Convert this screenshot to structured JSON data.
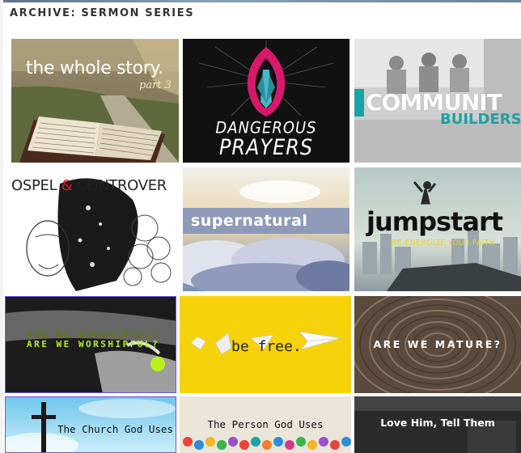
{
  "page": {
    "title": "ARCHIVE: SERMON SERIES"
  },
  "series": [
    {
      "title": "the whole story.",
      "subtitle": "part 3"
    },
    {
      "title": "DANGEROUS",
      "title2": "PRAYERS"
    },
    {
      "title": "COMMUNIT",
      "subtitle": "BUILDERS"
    },
    {
      "title": "OSPEL",
      "amp": "&",
      "title2": "CONTROVER"
    },
    {
      "title": "supernatural"
    },
    {
      "title": "jumpstart",
      "subtitle": "RE-ENERGIZE YOUR FAITH"
    },
    {
      "title": "ARE WE WORSHIPFUL?"
    },
    {
      "title": "be free."
    },
    {
      "title": "ARE WE MATURE?"
    },
    {
      "title": "The Church God Uses"
    },
    {
      "title": "The Person God Uses"
    },
    {
      "title": "Love Him, Tell Them"
    }
  ],
  "colors": {
    "accent_teal": "#1aa3a6",
    "jumpstart_yellow": "#e0d23a",
    "befree_yellow": "#f6d20b",
    "worship_lime": "#b9f21a"
  }
}
